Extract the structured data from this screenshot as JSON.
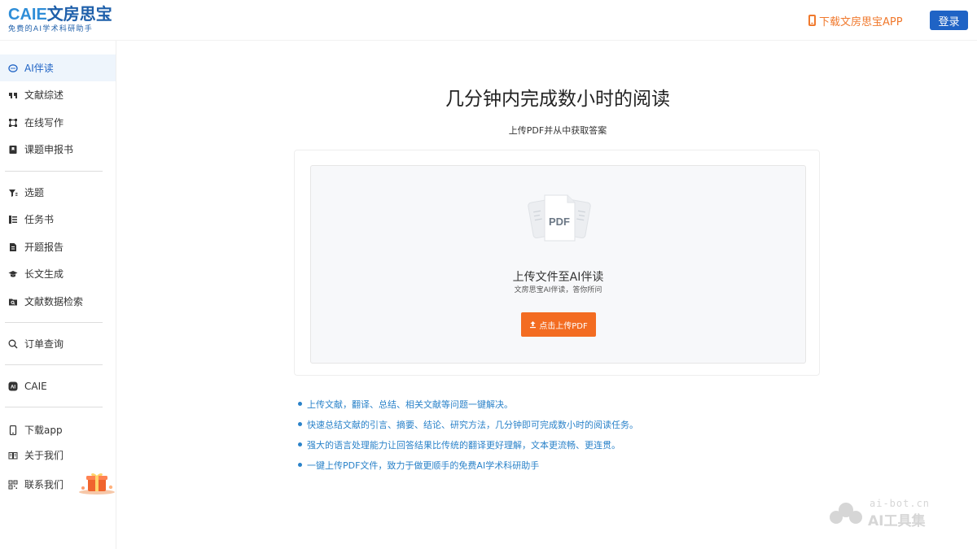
{
  "header": {
    "logo_en": "CAIE",
    "logo_cn": "文房思宝",
    "logo_tagline": "免费的AI学术科研助手",
    "download_label": "下载文房思宝APP",
    "login_label": "登录"
  },
  "sidebar": {
    "items": [
      {
        "label": "AI伴读",
        "icon": "chat-bubble-icon",
        "active": true
      },
      {
        "label": "文献综述",
        "icon": "quote-icon"
      },
      {
        "label": "在线写作",
        "icon": "write-icon"
      },
      {
        "label": "课题申报书",
        "icon": "bookmark-icon"
      },
      {
        "label": "选题",
        "icon": "filter-icon"
      },
      {
        "label": "任务书",
        "icon": "list-icon"
      },
      {
        "label": "开题报告",
        "icon": "document-icon"
      },
      {
        "label": "长文生成",
        "icon": "graduation-cap-icon"
      },
      {
        "label": "文献数据检索",
        "icon": "folder-search-icon"
      },
      {
        "label": "订单查询",
        "icon": "search-icon"
      },
      {
        "label": "CAIE",
        "icon": "ai-badge-icon"
      },
      {
        "label": "下载app",
        "icon": "mobile-icon"
      },
      {
        "label": "关于我们",
        "icon": "book-icon"
      },
      {
        "label": "联系我们",
        "icon": "qr-code-icon"
      }
    ]
  },
  "main": {
    "title": "几分钟内完成数小时的阅读",
    "subtitle": "上传PDF并从中获取答案",
    "upload": {
      "pdf_label": "PDF",
      "title": "上传文件至AI伴读",
      "description": "文房思宝AI伴读，答你所问",
      "button_label": "点击上传PDF"
    },
    "features": [
      "上传文献，翻译、总结、相关文献等问题一键解决。",
      "快速总结文献的引言、摘要、结论、研究方法，几分钟即可完成数小时的阅读任务。",
      "强大的语言处理能力让回答结果比传统的翻译更好理解，文本更流畅、更连贯。",
      "一键上传PDF文件，致力于做更顺手的免费AI学术科研助手"
    ]
  },
  "watermark": {
    "url": "ai-bot.cn",
    "name": "AI工具集"
  },
  "colors": {
    "brand_blue": "#1f63c5",
    "accent_orange": "#f36c21",
    "feature_blue": "#2a82c9"
  }
}
